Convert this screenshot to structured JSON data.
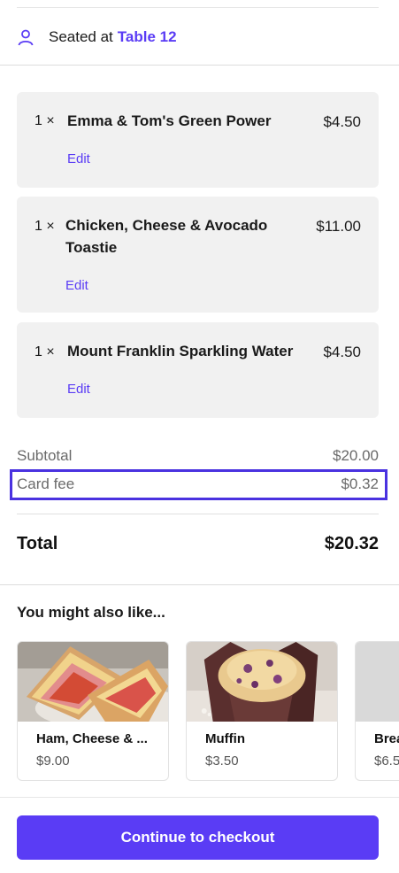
{
  "seating": {
    "prefix": "Seated at",
    "table": "Table 12"
  },
  "items": [
    {
      "qty": "1 ×",
      "name": "Emma & Tom's Green Power",
      "price": "$4.50",
      "edit": "Edit"
    },
    {
      "qty": "1 ×",
      "name_line1": "Chicken, Cheese & Avocado",
      "name_line2": "Toastie",
      "price": "$11.00",
      "edit": "Edit"
    },
    {
      "qty": "1 ×",
      "name": "Mount Franklin Sparkling Water",
      "price": "$4.50",
      "edit": "Edit"
    }
  ],
  "summary": {
    "subtotal_label": "Subtotal",
    "subtotal_value": "$20.00",
    "card_fee_label": "Card fee",
    "card_fee_value": "$0.32",
    "total_label": "Total",
    "total_value": "$20.32"
  },
  "suggestions": {
    "heading": "You might also like...",
    "items": [
      {
        "name": "Ham, Cheese & ...",
        "price": "$9.00"
      },
      {
        "name": "Muffin",
        "price": "$3.50"
      },
      {
        "name": "Brea",
        "price": "$6.5"
      }
    ]
  },
  "checkout": {
    "label": "Continue to checkout"
  },
  "colors": {
    "accent": "#5a3cf5",
    "highlight_border": "#4a32e0",
    "card_bg": "#f1f1f1"
  }
}
